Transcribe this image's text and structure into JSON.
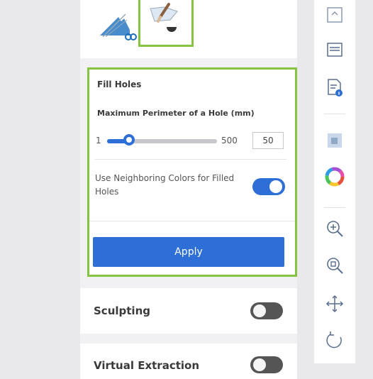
{
  "tools": [
    {
      "name": "fill-holes-tool-a"
    },
    {
      "name": "fill-holes-tool-b"
    }
  ],
  "fill_holes": {
    "title": "Fill Holes",
    "max_perimeter_label": "Maximum Perimeter of a Hole (mm)",
    "slider": {
      "min": "1",
      "max": "500",
      "value": 50,
      "value_text": "50"
    },
    "neighbor_label": "Use Neighboring Colors for Filled Holes",
    "neighbor_enabled": true,
    "apply_label": "Apply"
  },
  "sections": {
    "sculpting": {
      "label": "Sculpting",
      "enabled": false
    },
    "virtual_extraction": {
      "label": "Virtual Extraction",
      "enabled": false
    }
  },
  "toolbar_icons": [
    "grid-view-icon",
    "layout-icon",
    "document-info-icon",
    "shaded-view-icon",
    "color-wheel-icon",
    "zoom-in-icon",
    "zoom-fit-icon",
    "move-icon",
    "rotate-icon"
  ],
  "colors": {
    "accent": "#2d6fd6",
    "highlight": "#86c341"
  }
}
